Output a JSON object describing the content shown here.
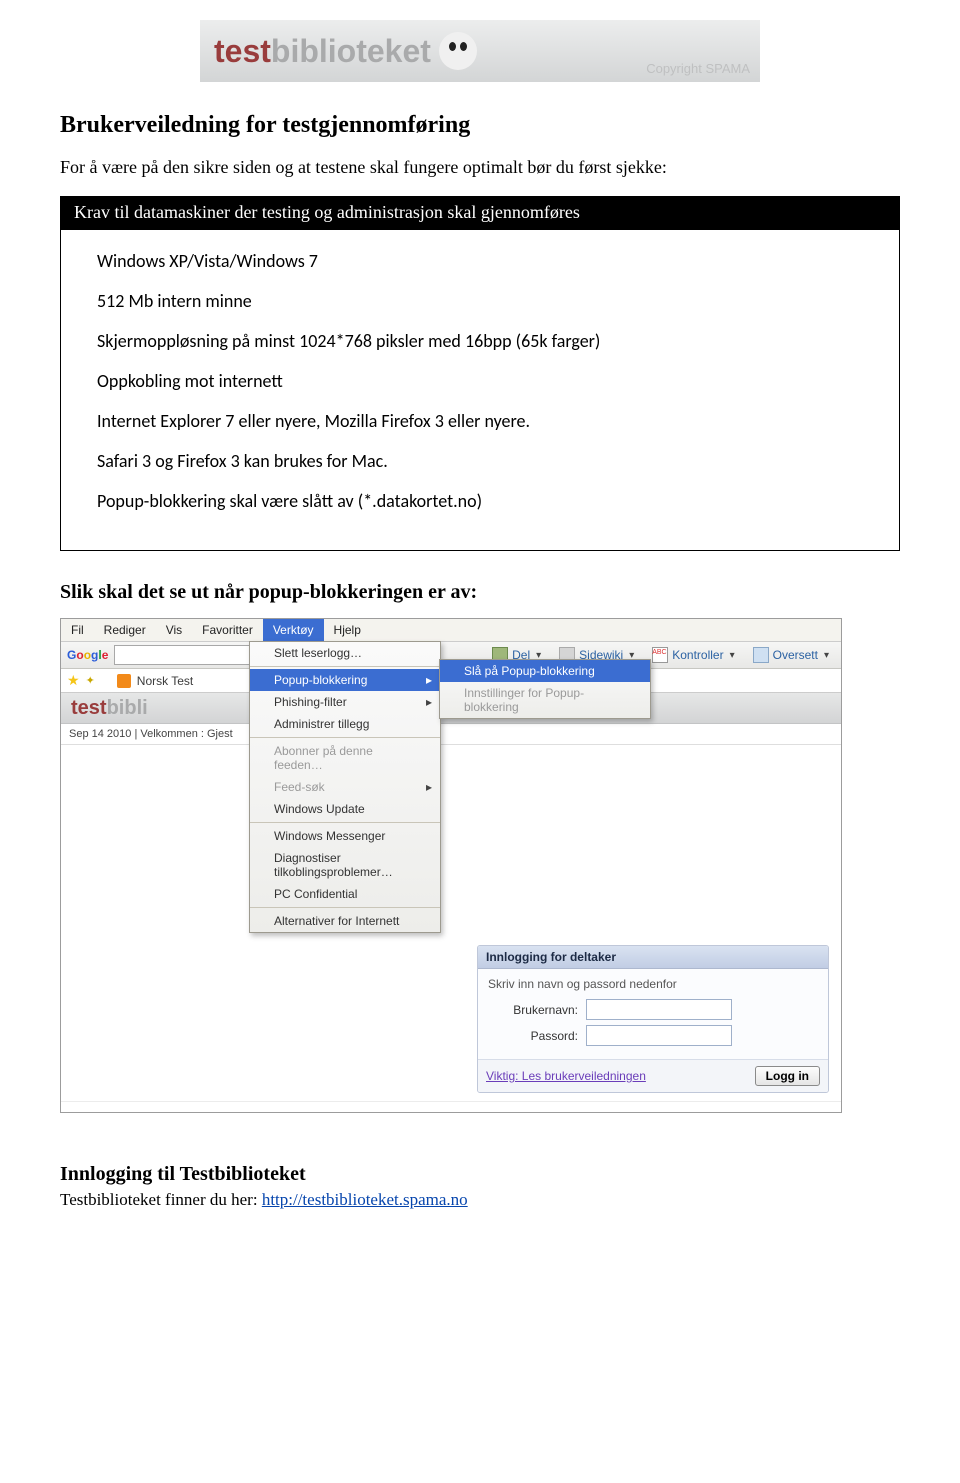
{
  "logo": {
    "part1": "test",
    "part2": "biblioteket",
    "copyright": "Copyright SPAMA"
  },
  "title": "Brukerveiledning for testgjennomføring",
  "intro": "For å være på den sikre siden og at testene skal fungere optimalt bør du først sjekke:",
  "req_header": "Krav til datamaskiner der testing og administrasjon skal gjennomføres",
  "requirements": [
    "Windows XP/Vista/Windows 7",
    "512 Mb intern minne",
    "Skjermoppløsning på minst 1024*768 piksler med 16bpp (65k farger)",
    "Oppkobling mot internett",
    "Internet Explorer 7 eller nyere, Mozilla Firefox 3 eller nyere.",
    "Safari 3 og Firefox 3 kan brukes for Mac.",
    "Popup-blokkering skal være slått av (*.datakortet.no)"
  ],
  "popup_heading": "Slik skal det se ut når popup-blokkeringen er av:",
  "screenshot": {
    "menubar": {
      "items": [
        "Fil",
        "Rediger",
        "Vis",
        "Favoritter",
        "Verktøy",
        "Hjelp"
      ],
      "selected_index": 4
    },
    "toolbar": {
      "google": "Google",
      "del": "Del",
      "sidewiki": "Sidewiki",
      "kontroller": "Kontroller",
      "oversett": "Oversett"
    },
    "favorites": {
      "tab_label": "Norsk Test"
    },
    "menu": {
      "items": [
        {
          "label": "Slett leserlogg…",
          "sep_after": true
        },
        {
          "label": "Popup-blokkering",
          "sub": true,
          "hi": true
        },
        {
          "label": "Phishing-filter",
          "sub": true
        },
        {
          "label": "Administrer tillegg",
          "sep_after": true
        },
        {
          "label": "Abonner på denne feeden…",
          "gray": true
        },
        {
          "label": "Feed-søk",
          "sub": true,
          "gray": true
        },
        {
          "label": "Windows Update",
          "sep_after": true
        },
        {
          "label": "Windows Messenger"
        },
        {
          "label": "Diagnostiser tilkoblingsproblemer…"
        },
        {
          "label": "PC Confidential",
          "sep_after": true
        },
        {
          "label": "Alternativer for Internett"
        }
      ]
    },
    "submenu": {
      "items": [
        {
          "label": "Slå på Popup-blokkering",
          "hi": true
        },
        {
          "label": "Innstillinger for Popup-blokkering",
          "gray": true
        }
      ]
    },
    "inner_logo": {
      "part1": "test",
      "part2": "bibli"
    },
    "datebar": "Sep 14 2010  |  Velkommen : Gjest",
    "login": {
      "head": "Innlogging for deltaker",
      "subtitle": "Skriv inn navn og passord nedenfor",
      "user_label": "Brukernavn:",
      "pass_label": "Passord:",
      "link": "Viktig: Les brukerveiledningen",
      "button": "Logg in"
    }
  },
  "section2": {
    "heading": "Innlogging til Testbiblioteket",
    "text": "Testbiblioteket finner du her: ",
    "url": "http://testbiblioteket.spama.no"
  }
}
